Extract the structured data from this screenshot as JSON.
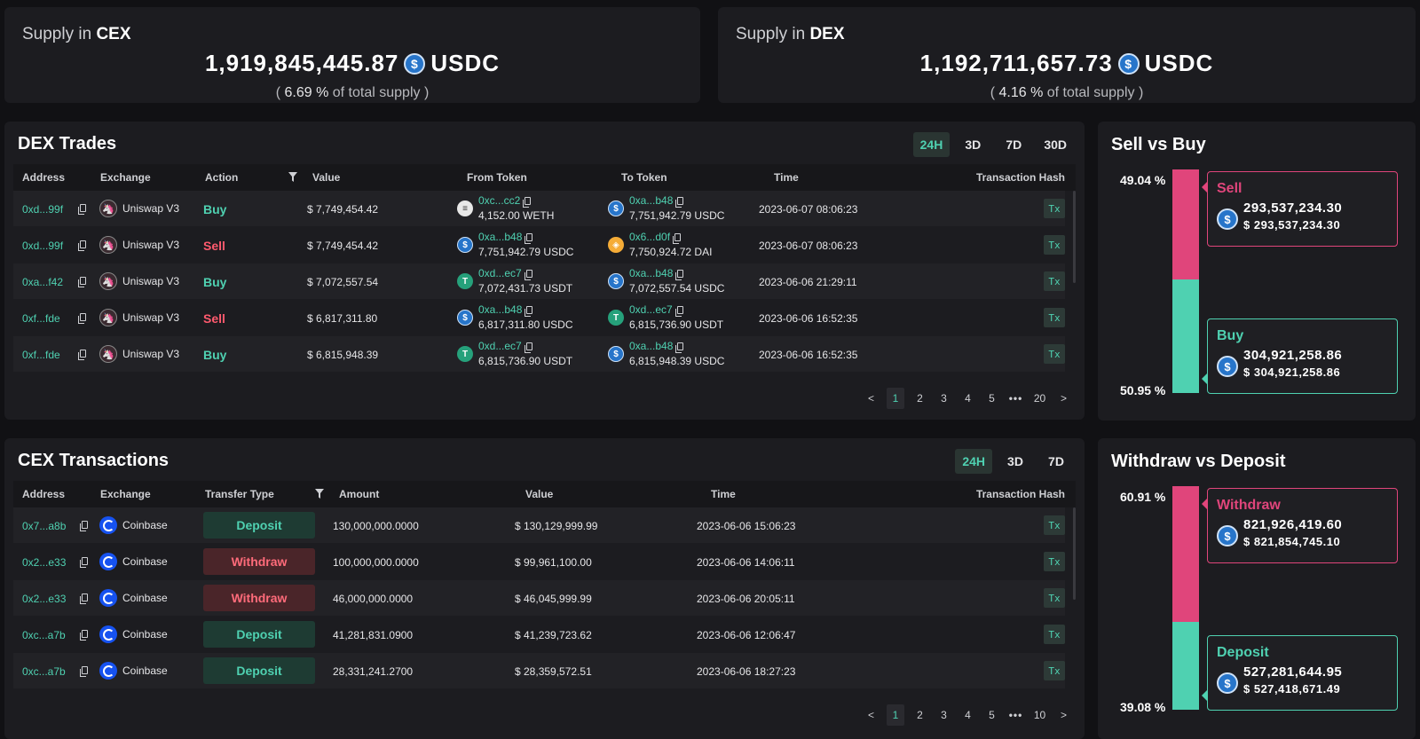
{
  "supply_cex": {
    "label": "Supply in ",
    "venue": "CEX",
    "amount": "1,919,845,445.87",
    "unit": "USDC",
    "pct": "6.69 %",
    "pct_suffix": "of total supply",
    "open": "(",
    "close": ")"
  },
  "supply_dex": {
    "label": "Supply in ",
    "venue": "DEX",
    "amount": "1,192,711,657.73",
    "unit": "USDC",
    "pct": "4.16 %",
    "pct_suffix": "of total supply",
    "open": "(",
    "close": ")"
  },
  "dex_trades": {
    "title": "DEX Trades",
    "tabs": [
      "24H",
      "3D",
      "7D",
      "30D"
    ],
    "active_tab": "24H",
    "columns": [
      "Address",
      "Exchange",
      "Action",
      "Value",
      "From Token",
      "To Token",
      "Time",
      "Transaction Hash"
    ],
    "rows": [
      {
        "address": "0xd...99f",
        "exchange": "Uniswap V3",
        "action": "Buy",
        "value": "$ 7,749,454.42",
        "from_addr": "0xc...cc2",
        "from_amt": "4,152.00 WETH",
        "from_icon": "weth",
        "to_addr": "0xa...b48",
        "to_amt": "7,751,942.79 USDC",
        "to_icon": "usdc",
        "time": "2023-06-07 08:06:23",
        "tx": "Tx"
      },
      {
        "address": "0xd...99f",
        "exchange": "Uniswap V3",
        "action": "Sell",
        "value": "$ 7,749,454.42",
        "from_addr": "0xa...b48",
        "from_amt": "7,751,942.79 USDC",
        "from_icon": "usdc",
        "to_addr": "0x6...d0f",
        "to_amt": "7,750,924.72 DAI",
        "to_icon": "dai",
        "time": "2023-06-07 08:06:23",
        "tx": "Tx"
      },
      {
        "address": "0xa...f42",
        "exchange": "Uniswap V3",
        "action": "Buy",
        "value": "$ 7,072,557.54",
        "from_addr": "0xd...ec7",
        "from_amt": "7,072,431.73 USDT",
        "from_icon": "usdt",
        "to_addr": "0xa...b48",
        "to_amt": "7,072,557.54 USDC",
        "to_icon": "usdc",
        "time": "2023-06-06 21:29:11",
        "tx": "Tx"
      },
      {
        "address": "0xf...fde",
        "exchange": "Uniswap V3",
        "action": "Sell",
        "value": "$ 6,817,311.80",
        "from_addr": "0xa...b48",
        "from_amt": "6,817,311.80 USDC",
        "from_icon": "usdc",
        "to_addr": "0xd...ec7",
        "to_amt": "6,815,736.90 USDT",
        "to_icon": "usdt",
        "time": "2023-06-06 16:52:35",
        "tx": "Tx"
      },
      {
        "address": "0xf...fde",
        "exchange": "Uniswap V3",
        "action": "Buy",
        "value": "$ 6,815,948.39",
        "from_addr": "0xd...ec7",
        "from_amt": "6,815,736.90 USDT",
        "from_icon": "usdt",
        "to_addr": "0xa...b48",
        "to_amt": "6,815,948.39 USDC",
        "to_icon": "usdc",
        "time": "2023-06-06 16:52:35",
        "tx": "Tx"
      }
    ],
    "pager": {
      "pages": [
        "1",
        "2",
        "3",
        "4",
        "5"
      ],
      "current": "1",
      "dots": "•••",
      "last": "20"
    }
  },
  "cex_tx": {
    "title": "CEX Transactions",
    "tabs": [
      "24H",
      "3D",
      "7D"
    ],
    "active_tab": "24H",
    "columns": [
      "Address",
      "Exchange",
      "Transfer Type",
      "Amount",
      "Value",
      "Time",
      "Transaction Hash"
    ],
    "rows": [
      {
        "address": "0x7...a8b",
        "exchange": "Coinbase",
        "type": "Deposit",
        "amount": "130,000,000.0000",
        "value": "$ 130,129,999.99",
        "time": "2023-06-06 15:06:23",
        "tx": "Tx"
      },
      {
        "address": "0x2...e33",
        "exchange": "Coinbase",
        "type": "Withdraw",
        "amount": "100,000,000.0000",
        "value": "$ 99,961,100.00",
        "time": "2023-06-06 14:06:11",
        "tx": "Tx"
      },
      {
        "address": "0x2...e33",
        "exchange": "Coinbase",
        "type": "Withdraw",
        "amount": "46,000,000.0000",
        "value": "$ 46,045,999.99",
        "time": "2023-06-06 20:05:11",
        "tx": "Tx"
      },
      {
        "address": "0xc...a7b",
        "exchange": "Coinbase",
        "type": "Deposit",
        "amount": "41,281,831.0900",
        "value": "$ 41,239,723.62",
        "time": "2023-06-06 12:06:47",
        "tx": "Tx"
      },
      {
        "address": "0xc...a7b",
        "exchange": "Coinbase",
        "type": "Deposit",
        "amount": "28,331,241.2700",
        "value": "$ 28,359,572.51",
        "time": "2023-06-06 18:27:23",
        "tx": "Tx"
      }
    ],
    "pager": {
      "pages": [
        "1",
        "2",
        "3",
        "4",
        "5"
      ],
      "current": "1",
      "dots": "•••",
      "last": "10"
    }
  },
  "sell_buy": {
    "title": "Sell vs Buy",
    "top_pct": "49.04 %",
    "bottom_pct": "50.95 %",
    "top_share": 0.4904,
    "sell": {
      "label": "Sell",
      "amount": "293,537,234.30",
      "usd": "$ 293,537,234.30"
    },
    "buy": {
      "label": "Buy",
      "amount": "304,921,258.86",
      "usd": "$ 304,921,258.86"
    }
  },
  "withdraw_deposit": {
    "title": "Withdraw vs Deposit",
    "top_pct": "60.91 %",
    "bottom_pct": "39.08 %",
    "top_share": 0.6091,
    "withdraw": {
      "label": "Withdraw",
      "amount": "821,926,419.60",
      "usd": "$ 821,854,745.10"
    },
    "deposit": {
      "label": "Deposit",
      "amount": "527,281,644.95",
      "usd": "$ 527,418,671.49"
    }
  },
  "colors": {
    "accent": "#4fd1b1",
    "sell": "#e0457b",
    "withdraw": "#ff6b7a",
    "usdc": "#2775ca"
  },
  "icons": {
    "usdc": "$",
    "usdt": "T",
    "dai": "◈",
    "weth": "≡",
    "uniswap": "🦄",
    "copy": "copy-icon",
    "filter": "filter-icon"
  }
}
